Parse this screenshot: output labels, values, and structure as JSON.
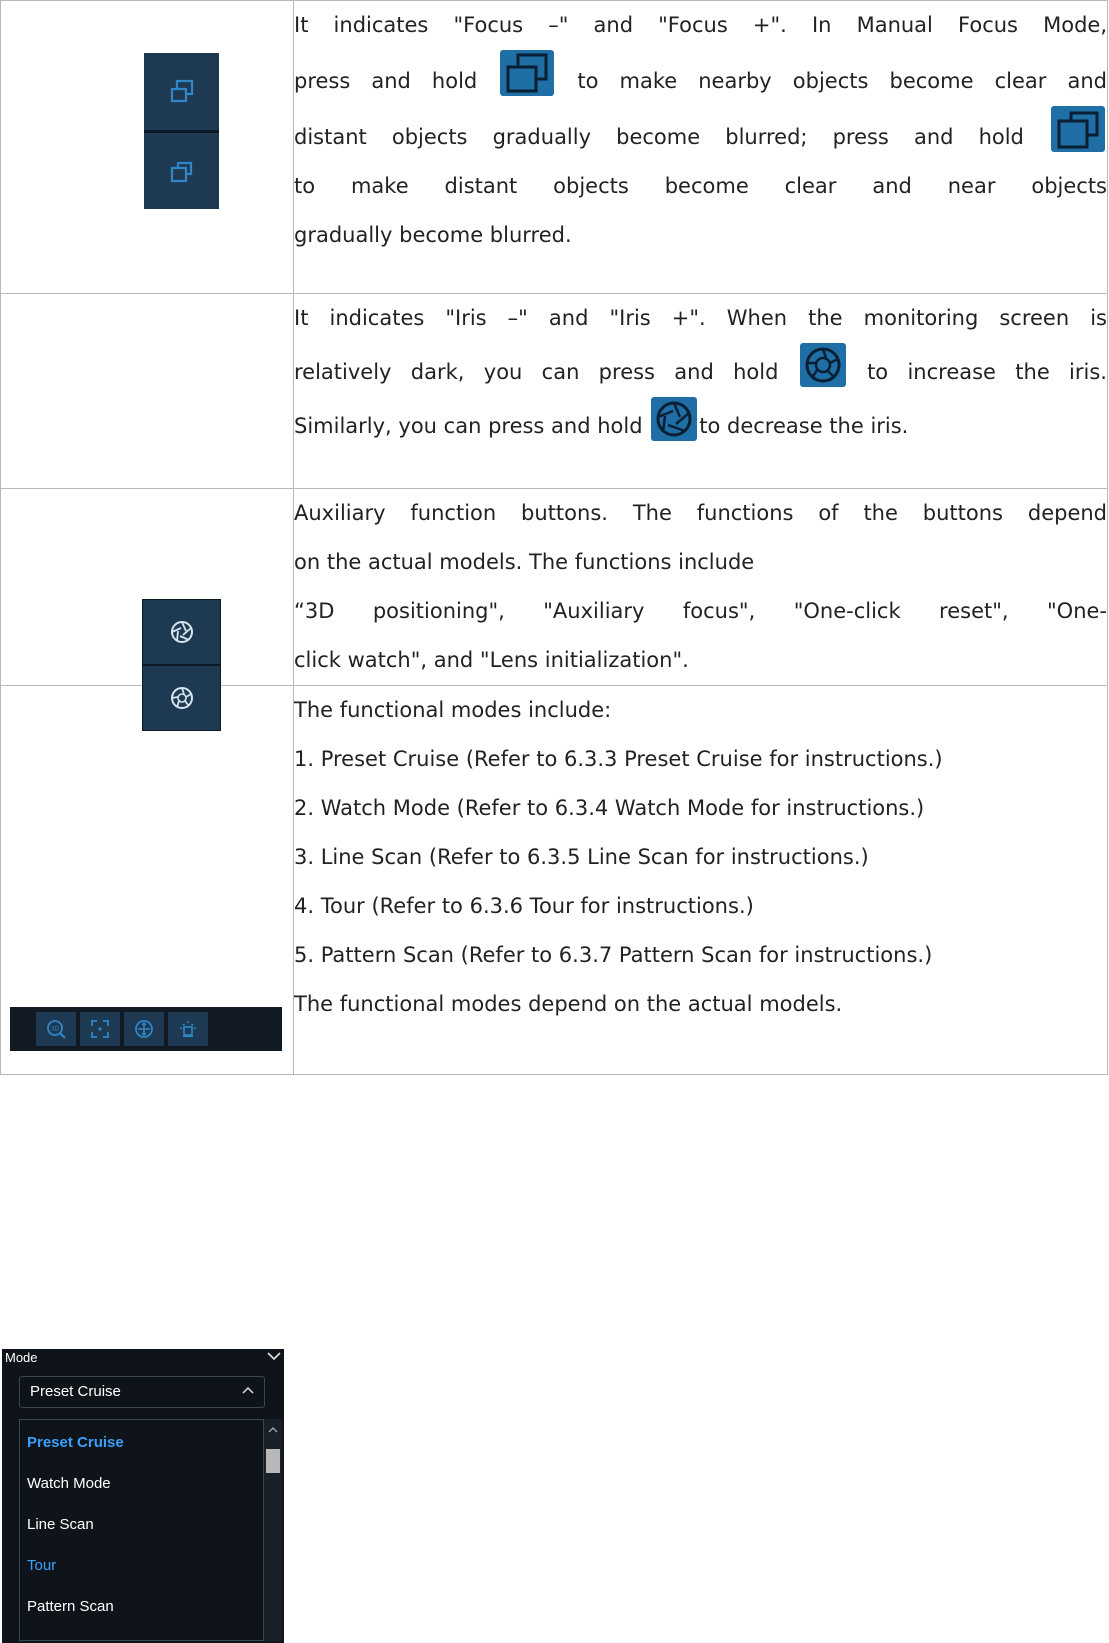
{
  "rows": [
    {
      "lines": [
        "It indicates \"Focus –\" and \"Focus +\". In Manual Focus Mode,",
        [
          "press and hold ",
          " to make nearby objects become clear and"
        ],
        [
          "distant objects gradually become blurred; press and hold ",
          ""
        ],
        "to make distant objects become clear and near objects",
        "gradually become blurred."
      ]
    }
  ],
  "focus_text": {
    "l1": "It indicates \"Focus –\" and \"Focus +\". In Manual Focus Mode,",
    "l2a": "press and hold",
    "l2b": "to make nearby objects become clear and",
    "l3a": "distant objects gradually become blurred; press and hold",
    "l4": "to make distant objects become clear and near objects",
    "l5": "gradually become blurred."
  },
  "iris_text": {
    "l1": "It indicates \"Iris –\" and \"Iris +\". When the monitoring screen is",
    "l2a": "relatively dark, you can press and hold",
    "l2b": "to increase the iris.",
    "l3a": "Similarly, you can press and hold",
    "l3b": "to decrease the iris."
  },
  "aux_text": {
    "l1": "Auxiliary function buttons. The functions of the buttons depend",
    "l2": "on the actual models. The functions include",
    "l3": "“3D positioning\", \"Auxiliary focus\", \"One-click reset\", \"One-",
    "l4": "click watch\", and \"Lens initialization\"."
  },
  "mode_text": {
    "l1": "The functional modes include:",
    "l2": "1. Preset Cruise (Refer to 6.3.3 Preset Cruise for instructions.)",
    "l3": "2. Watch Mode (Refer to 6.3.4 Watch Mode for instructions.)",
    "l4": "3. Line Scan (Refer to 6.3.5 Line Scan for instructions.)",
    "l5": "4. Tour (Refer to 6.3.6 Tour for instructions.)",
    "l6": "5. Pattern Scan (Refer to 6.3.7 Pattern Scan for instructions.)",
    "l7": "The functional modes depend on the actual models."
  },
  "mode_panel": {
    "label": "Mode",
    "selected": "Preset Cruise",
    "options": [
      "Preset Cruise",
      "Watch Mode",
      "Line Scan",
      "Tour",
      "Pattern Scan"
    ]
  },
  "colors": {
    "panel_bg": "#1e3a52",
    "icon_blue": "#2f86c9",
    "accent_blue": "#3aa0ff"
  },
  "icons": [
    "focus-near-icon",
    "focus-far-icon",
    "iris-close-icon",
    "iris-open-icon",
    "3d-positioning-icon",
    "auxiliary-focus-icon",
    "one-click-reset-icon",
    "lens-initialization-icon"
  ]
}
